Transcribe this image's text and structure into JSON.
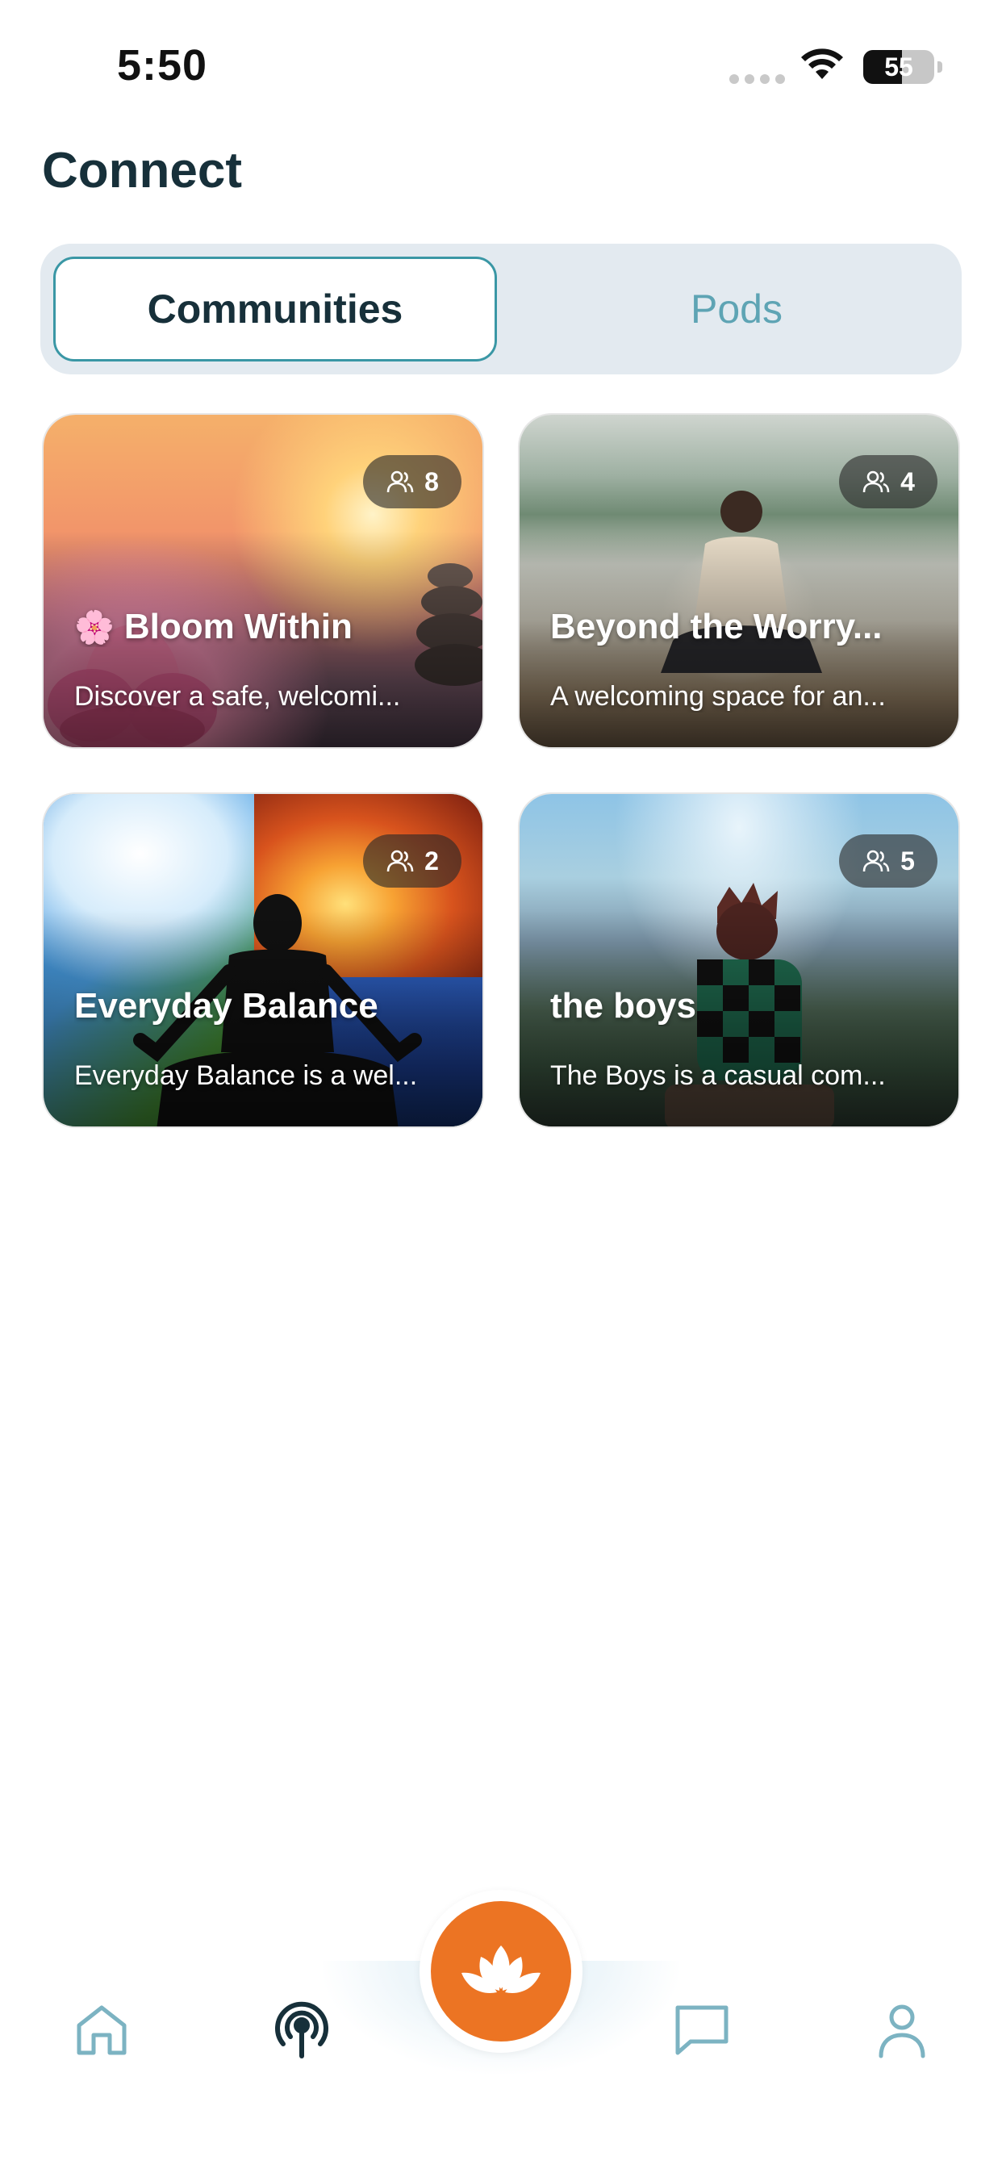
{
  "status_bar": {
    "time": "5:50",
    "battery": "55",
    "battery_level": 0.55
  },
  "page": {
    "title": "Connect"
  },
  "segmented_control": {
    "active": "Communities",
    "inactive": "Pods"
  },
  "communities": [
    {
      "emoji": "🌸",
      "title": "Bloom Within",
      "description": "Discover a safe, welcomi...",
      "members": "8"
    },
    {
      "emoji": "",
      "title": "Beyond the Worry...",
      "description": "A welcoming space for an...",
      "members": "4"
    },
    {
      "emoji": "",
      "title": "Everyday Balance",
      "description": "Everyday Balance is a wel...",
      "members": "2"
    },
    {
      "emoji": "",
      "title": "the boys",
      "description": "The Boys is a casual com...",
      "members": "5"
    }
  ],
  "nav": {
    "items": [
      "home-icon",
      "podcast-icon",
      "lotus-icon",
      "chat-icon",
      "profile-icon"
    ],
    "active": "podcast-icon"
  },
  "colors": {
    "accent_teal": "#3a97a5",
    "inactive_teal": "#5ea4b4",
    "lotus_orange": "#ec7423",
    "title_dark": "#17303a"
  }
}
